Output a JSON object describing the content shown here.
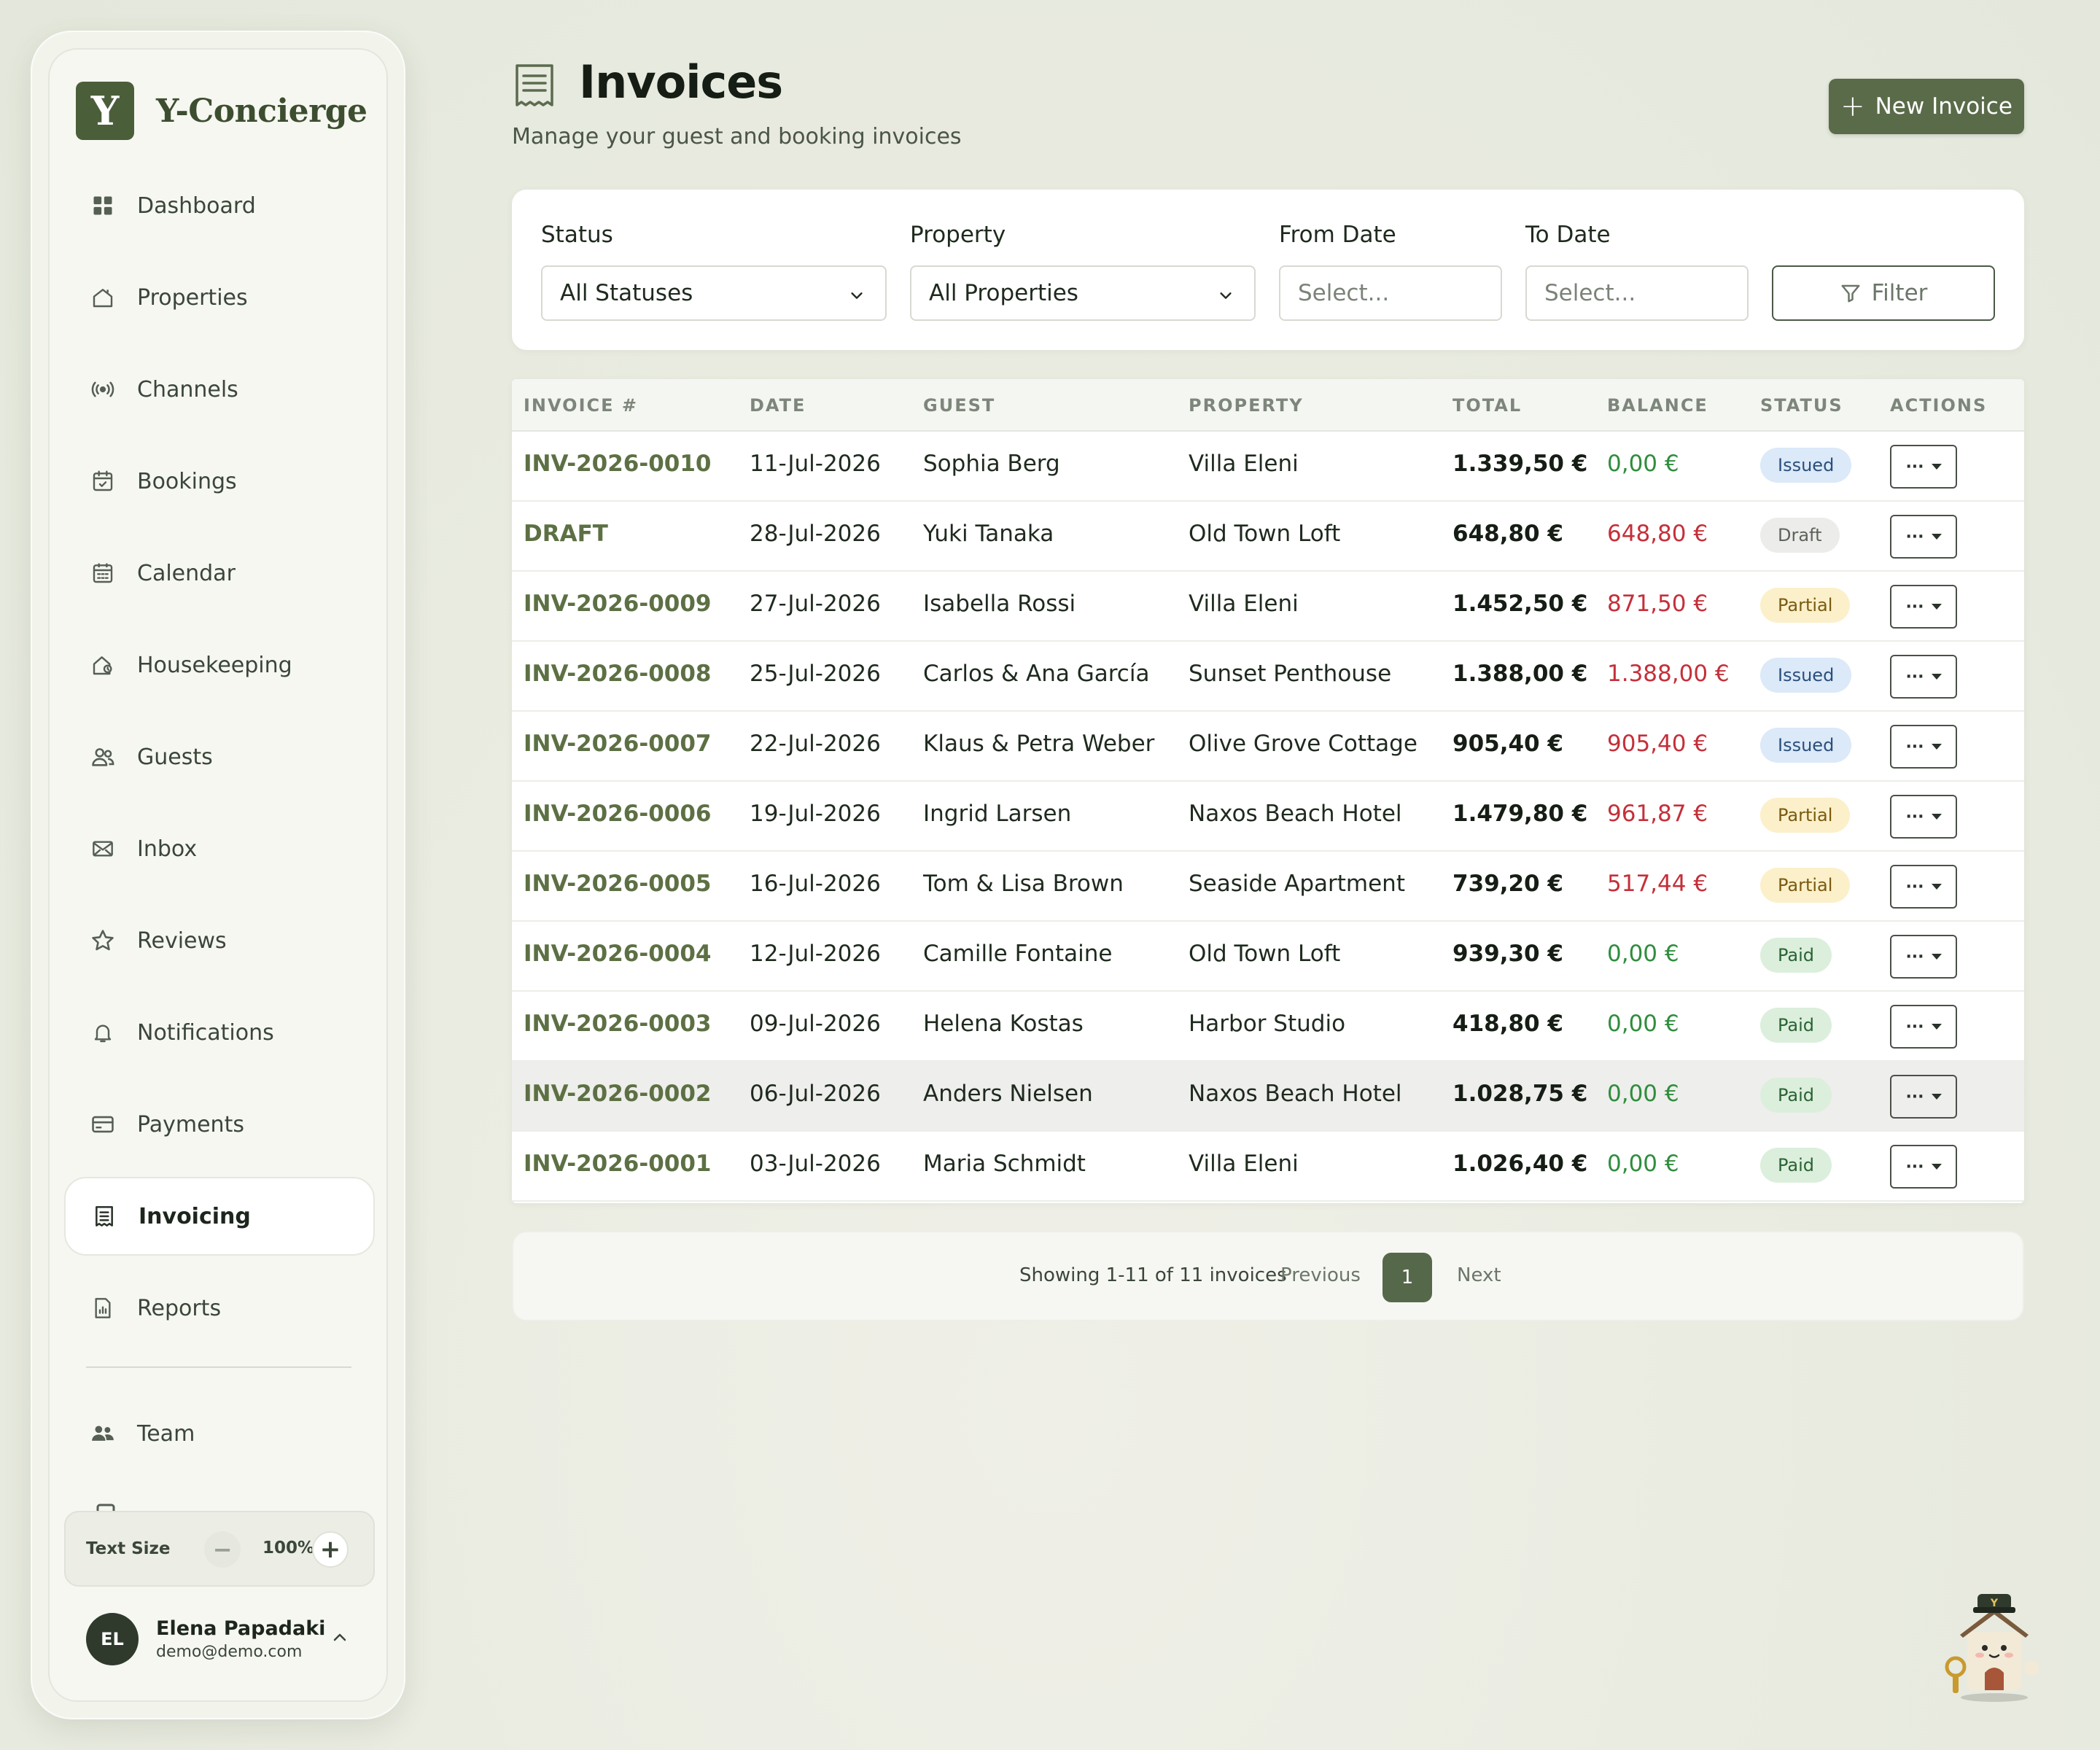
{
  "brand": {
    "logo_letter": "Y",
    "name": "Y-Concierge"
  },
  "sidebar": {
    "items": [
      {
        "label": "Dashboard",
        "icon": "grid-icon"
      },
      {
        "label": "Properties",
        "icon": "house-icon"
      },
      {
        "label": "Channels",
        "icon": "broadcast-icon"
      },
      {
        "label": "Bookings",
        "icon": "calendar-check-icon"
      },
      {
        "label": "Calendar",
        "icon": "calendar-icon"
      },
      {
        "label": "Housekeeping",
        "icon": "house-clean-icon"
      },
      {
        "label": "Guests",
        "icon": "users-icon"
      },
      {
        "label": "Inbox",
        "icon": "envelope-icon"
      },
      {
        "label": "Reviews",
        "icon": "star-icon"
      },
      {
        "label": "Notifications",
        "icon": "bell-icon"
      },
      {
        "label": "Payments",
        "icon": "credit-card-icon"
      },
      {
        "label": "Invoicing",
        "icon": "receipt-icon",
        "active": true
      },
      {
        "label": "Reports",
        "icon": "report-icon"
      }
    ],
    "team": {
      "label": "Team",
      "icon": "team-icon"
    },
    "text_size": {
      "label": "Text Size",
      "minus": "−",
      "value": "100%",
      "plus": "+"
    },
    "user": {
      "initials": "EL",
      "name": "Elena Papadaki",
      "email": "demo@demo.com"
    }
  },
  "header": {
    "title": "Invoices",
    "subtitle": "Manage your guest and booking invoices",
    "new_invoice_icon": "+",
    "new_invoice_label": "New Invoice"
  },
  "filters": {
    "status": {
      "label": "Status",
      "value": "All Statuses"
    },
    "property": {
      "label": "Property",
      "value": "All Properties"
    },
    "from_date": {
      "label": "From Date",
      "placeholder": "Select..."
    },
    "to_date": {
      "label": "To Date",
      "placeholder": "Select..."
    },
    "filter_button": "Filter"
  },
  "table": {
    "columns": [
      "INVOICE #",
      "DATE",
      "GUEST",
      "PROPERTY",
      "TOTAL",
      "BALANCE",
      "STATUS",
      "ACTIONS"
    ],
    "rows": [
      {
        "invoice": "INV-2026-0010",
        "date": "11-Jul-2026",
        "guest": "Sophia Berg",
        "property": "Villa Eleni",
        "total": "1.339,50 €",
        "balance": "0,00 €",
        "balance_state": "ok",
        "status": "Issued",
        "status_key": "issued"
      },
      {
        "invoice": "DRAFT",
        "date": "28-Jul-2026",
        "guest": "Yuki Tanaka",
        "property": "Old Town Loft",
        "total": "648,80 €",
        "balance": "648,80 €",
        "balance_state": "due",
        "status": "Draft",
        "status_key": "draft"
      },
      {
        "invoice": "INV-2026-0009",
        "date": "27-Jul-2026",
        "guest": "Isabella Rossi",
        "property": "Villa Eleni",
        "total": "1.452,50 €",
        "balance": "871,50 €",
        "balance_state": "due",
        "status": "Partial",
        "status_key": "partial"
      },
      {
        "invoice": "INV-2026-0008",
        "date": "25-Jul-2026",
        "guest": "Carlos & Ana García",
        "property": "Sunset Penthouse",
        "total": "1.388,00 €",
        "balance": "1.388,00 €",
        "balance_state": "due",
        "status": "Issued",
        "status_key": "issued"
      },
      {
        "invoice": "INV-2026-0007",
        "date": "22-Jul-2026",
        "guest": "Klaus & Petra Weber",
        "property": "Olive Grove Cottage",
        "total": "905,40 €",
        "balance": "905,40 €",
        "balance_state": "due",
        "status": "Issued",
        "status_key": "issued"
      },
      {
        "invoice": "INV-2026-0006",
        "date": "19-Jul-2026",
        "guest": "Ingrid Larsen",
        "property": "Naxos Beach Hotel",
        "total": "1.479,80 €",
        "balance": "961,87 €",
        "balance_state": "due",
        "status": "Partial",
        "status_key": "partial"
      },
      {
        "invoice": "INV-2026-0005",
        "date": "16-Jul-2026",
        "guest": "Tom & Lisa Brown",
        "property": "Seaside Apartment",
        "total": "739,20 €",
        "balance": "517,44 €",
        "balance_state": "due",
        "status": "Partial",
        "status_key": "partial"
      },
      {
        "invoice": "INV-2026-0004",
        "date": "12-Jul-2026",
        "guest": "Camille Fontaine",
        "property": "Old Town Loft",
        "total": "939,30 €",
        "balance": "0,00 €",
        "balance_state": "ok",
        "status": "Paid",
        "status_key": "paid"
      },
      {
        "invoice": "INV-2026-0003",
        "date": "09-Jul-2026",
        "guest": "Helena Kostas",
        "property": "Harbor Studio",
        "total": "418,80 €",
        "balance": "0,00 €",
        "balance_state": "ok",
        "status": "Paid",
        "status_key": "paid"
      },
      {
        "invoice": "INV-2026-0002",
        "date": "06-Jul-2026",
        "guest": "Anders Nielsen",
        "property": "Naxos Beach Hotel",
        "total": "1.028,75 €",
        "balance": "0,00 €",
        "balance_state": "ok",
        "status": "Paid",
        "status_key": "paid",
        "hovered": true
      },
      {
        "invoice": "INV-2026-0001",
        "date": "03-Jul-2026",
        "guest": "Maria Schmidt",
        "property": "Villa Eleni",
        "total": "1.026,40 €",
        "balance": "0,00 €",
        "balance_state": "ok",
        "status": "Paid",
        "status_key": "paid"
      }
    ],
    "action_label": "···"
  },
  "pagination": {
    "info": "Showing 1-11 of 11 invoices",
    "previous": "Previous",
    "current": "1",
    "next": "Next"
  },
  "colors": {
    "accent": "#5a6b49",
    "ok": "#2f8d3d",
    "due": "#c4303a"
  }
}
